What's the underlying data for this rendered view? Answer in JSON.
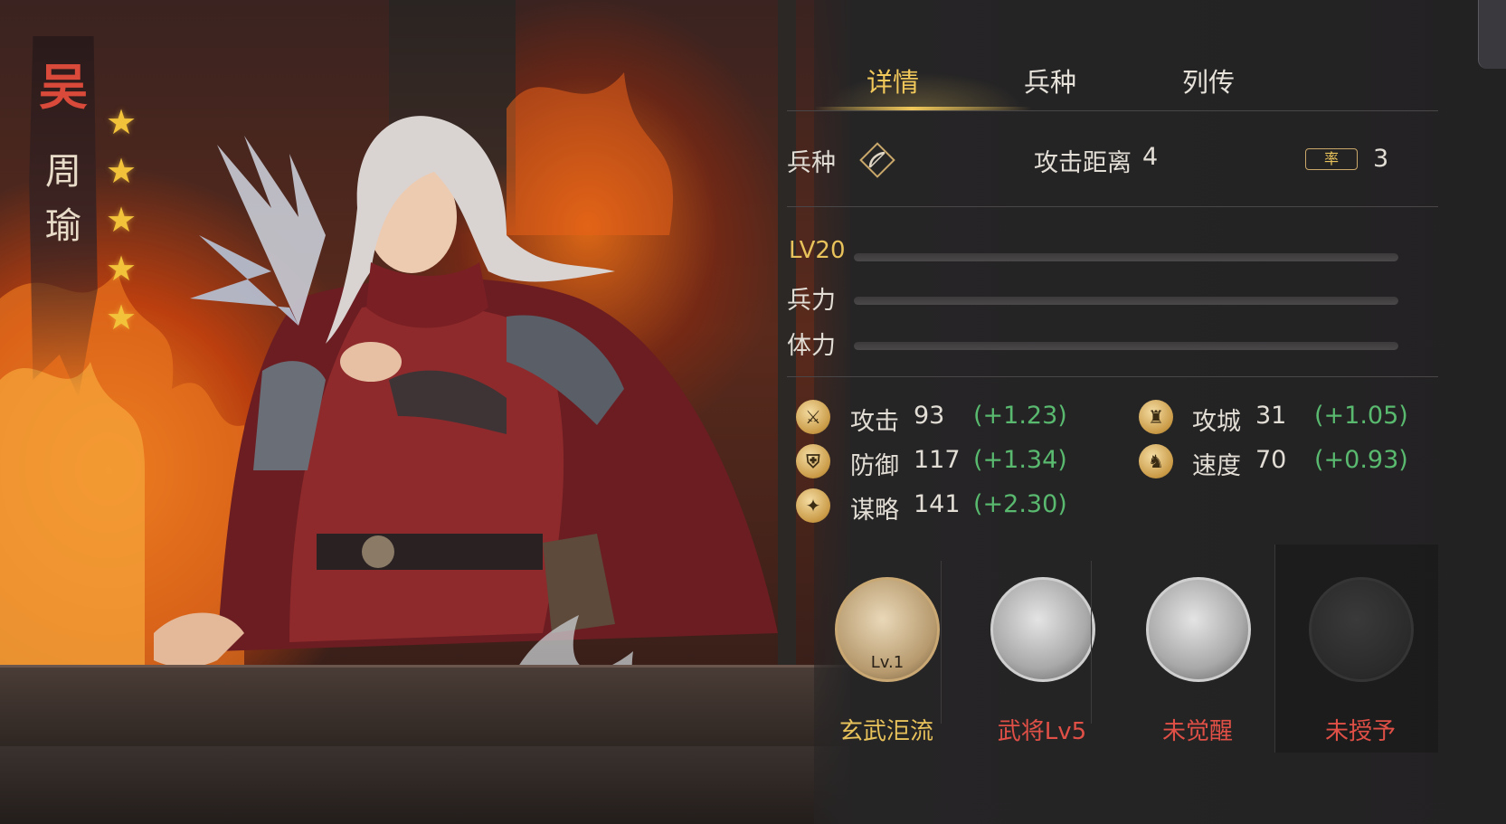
{
  "hero": {
    "faction": "吴",
    "name_chars": [
      "周",
      "瑜"
    ],
    "stars": 5
  },
  "tabs": [
    {
      "label": "详情",
      "active": true
    },
    {
      "label": "兵种",
      "active": false
    },
    {
      "label": "列传",
      "active": false
    }
  ],
  "unit": {
    "type_label": "兵种",
    "type_icon": "bow-icon",
    "range_label": "攻击距离",
    "range_value": "4",
    "cost_icon": "lead-cost-icon",
    "cost_icon_text": "率",
    "cost_value": "3"
  },
  "progress": {
    "level_label": "LV20",
    "level_fill": 0,
    "troops_label": "兵力",
    "troops_fill": 0,
    "stamina_label": "体力",
    "stamina_fill": 0
  },
  "stats": [
    {
      "icon": "sword-icon",
      "glyph": "⚔",
      "label": "攻击",
      "value": "93",
      "bonus": "(+1.23)"
    },
    {
      "icon": "shield-icon",
      "glyph": "⛨",
      "label": "防御",
      "value": "117",
      "bonus": "(+1.34)"
    },
    {
      "icon": "strategy-icon",
      "glyph": "✦",
      "label": "谋略",
      "value": "141",
      "bonus": "(+2.30)"
    },
    {
      "icon": "siege-icon",
      "glyph": "♜",
      "label": "攻城",
      "value": "31",
      "bonus": "(+1.05)"
    },
    {
      "icon": "horse-icon",
      "glyph": "♞",
      "label": "速度",
      "value": "70",
      "bonus": "(+0.93)"
    }
  ],
  "skills": [
    {
      "name": "玄武洰流",
      "level": "Lv.1",
      "style": "gold",
      "color": "#e8c25a"
    },
    {
      "name": "武将Lv5",
      "level": "",
      "style": "silver",
      "color": "#e05046"
    },
    {
      "name": "未觉醒",
      "level": "",
      "style": "silver",
      "color": "#e05046"
    },
    {
      "name": "未授予",
      "level": "",
      "style": "locked",
      "color": "#e05046"
    }
  ],
  "colors": {
    "accent_gold": "#f1c85a",
    "bonus_green": "#59b96f",
    "warn_red": "#e05046"
  }
}
